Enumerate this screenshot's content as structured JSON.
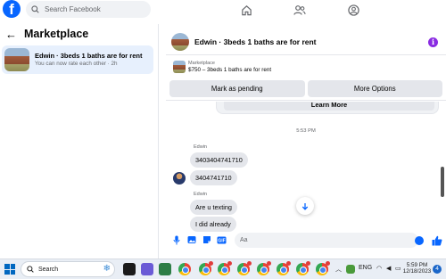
{
  "topbar": {
    "search_placeholder": "Search Facebook"
  },
  "sidebar": {
    "title": "Marketplace",
    "conversation": {
      "title": "Edwin · 3beds 1 baths are for rent",
      "subtitle": "You can now rate each other · 2h"
    }
  },
  "chat": {
    "title": "Edwin · 3beds 1 baths are for rent",
    "listing": {
      "label": "Marketplace",
      "price_title": "$750 – 3beds 1 baths are for rent",
      "mark_pending_label": "Mark as pending",
      "more_options_label": "More Options"
    },
    "learn_more_label": "Learn More",
    "timestamp": "5:53 PM",
    "messages": [
      {
        "sender": "Edwin",
        "text": "3403404741710"
      },
      {
        "text": "3404741710"
      },
      {
        "sender": "Edwin",
        "text": "Are u texting"
      },
      {
        "text": "I did already"
      }
    ],
    "composer_placeholder": "Aa"
  },
  "taskbar": {
    "search_label": "Search",
    "lang": "ENG",
    "time": "5:59 PM",
    "date": "12/18/2023",
    "notification_count": "4"
  },
  "colors": {
    "brand": "#0866ff",
    "selected_bg": "#e7f0fd",
    "info_purple": "#8a2be2"
  }
}
